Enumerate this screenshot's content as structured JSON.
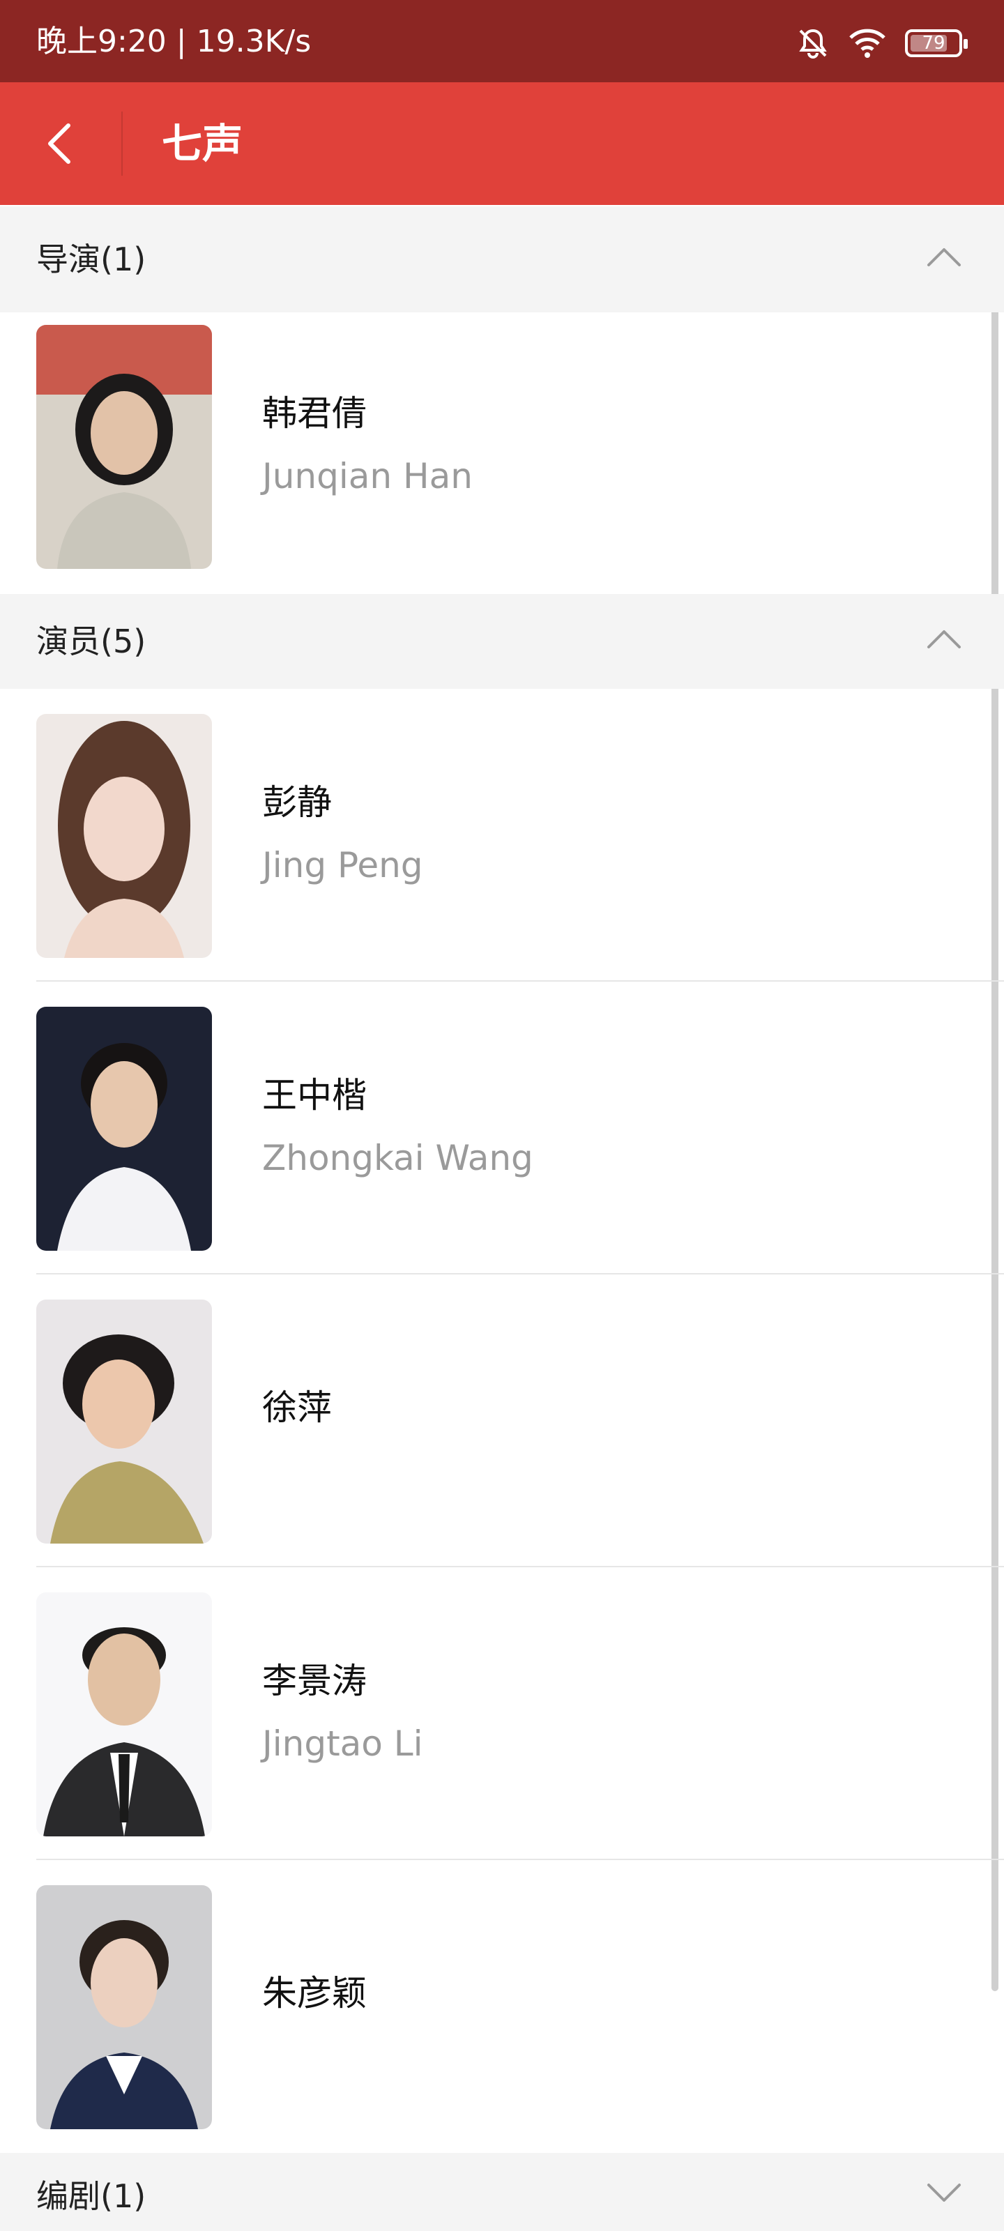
{
  "status_bar": {
    "time_speed": "晚上9:20 | 19.3K/s",
    "battery": "79",
    "battery_level": 0.79,
    "icons": [
      "bell-off-icon",
      "wifi-icon",
      "battery-icon"
    ]
  },
  "header": {
    "title": "七声",
    "back_icon": "chevron-left-icon"
  },
  "sections": {
    "directors": {
      "title": "导演(1)",
      "expanded": true
    },
    "actors": {
      "title": "演员(5)",
      "expanded": true
    },
    "writers": {
      "title": "编剧(1)",
      "expanded": false
    }
  },
  "people": {
    "han": {
      "name_cn": "韩君倩",
      "name_en": "Junqian Han"
    },
    "peng": {
      "name_cn": "彭静",
      "name_en": "Jing Peng"
    },
    "wang": {
      "name_cn": "王中楷",
      "name_en": "Zhongkai Wang"
    },
    "xu": {
      "name_cn": "徐萍",
      "name_en": ""
    },
    "li": {
      "name_cn": "李景涛",
      "name_en": "Jingtao Li"
    },
    "zhu": {
      "name_cn": "朱彦颖",
      "name_en": ""
    }
  },
  "colors": {
    "status_bar": "#8c2623",
    "app_bar": "#e0413a",
    "section_bg": "#f4f4f4"
  }
}
